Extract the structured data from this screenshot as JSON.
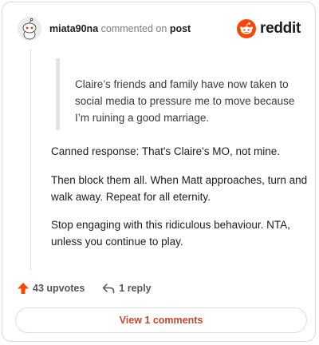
{
  "header": {
    "username": "miata90na",
    "action_text": "commented on",
    "post_link": "post",
    "brand": "reddit"
  },
  "comment": {
    "quote": "Claire’s friends and family have now taken to social media to pressure me to move because I’m ruining a good marriage.",
    "paragraphs": [
      "Canned response: That's Claire's MO, not mine.",
      "Then block them all. When Matt approaches, turn and walk away. Repeat for all eternity.",
      "Stop engaging with this ridiculous behaviour. NTA, unless you continue to play."
    ]
  },
  "actions": {
    "upvotes": "43 upvotes",
    "replies": "1 reply"
  },
  "footer": {
    "view_comments": "View 1 comments"
  },
  "colors": {
    "brand_orange": "#ff4500",
    "upvote_orange": "#ff4500",
    "link_red": "#c8462a"
  }
}
